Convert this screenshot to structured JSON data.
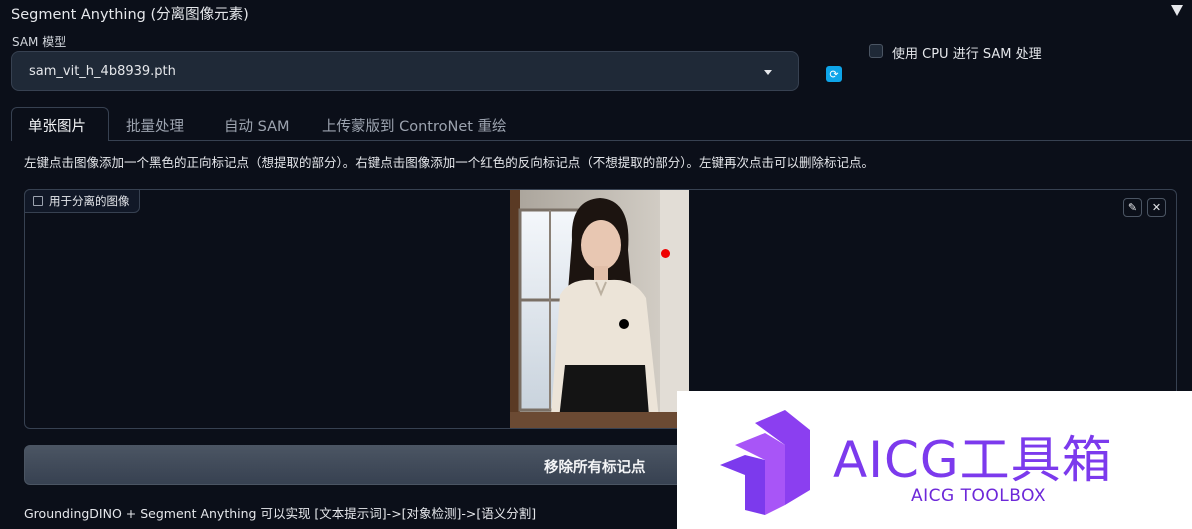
{
  "section": {
    "title": "Segment Anything (分离图像元素)"
  },
  "model": {
    "label": "SAM 模型",
    "selected": "sam_vit_h_4b8939.pth"
  },
  "cpu_option": {
    "label": "使用 CPU 进行 SAM 处理",
    "checked": false
  },
  "tabs": [
    {
      "label": "单张图片",
      "active": true
    },
    {
      "label": "批量处理",
      "active": false
    },
    {
      "label": "自动 SAM",
      "active": false
    },
    {
      "label": "上传蒙版到 ControNet 重绘",
      "active": false
    }
  ],
  "instructions": "左键点击图像添加一个黑色的正向标记点（想提取的部分）。右键点击图像添加一个红色的反向标记点（不想提取的部分）。左键再次点击可以删除标记点。",
  "image_panel": {
    "label": "用于分离的图像"
  },
  "remove_button": {
    "label": "移除所有标记点"
  },
  "footer": "GroundingDINO + Segment Anything 可以实现 [文本提示词]->[对象检测]->[语义分割]",
  "watermark": {
    "title": "AICG工具箱",
    "subtitle": "AICG TOOLBOX"
  },
  "colors": {
    "accent_refresh": "#0ea5e9",
    "positive_point": "#000000",
    "negative_point": "#ef0000",
    "watermark": "#7c3aed"
  }
}
